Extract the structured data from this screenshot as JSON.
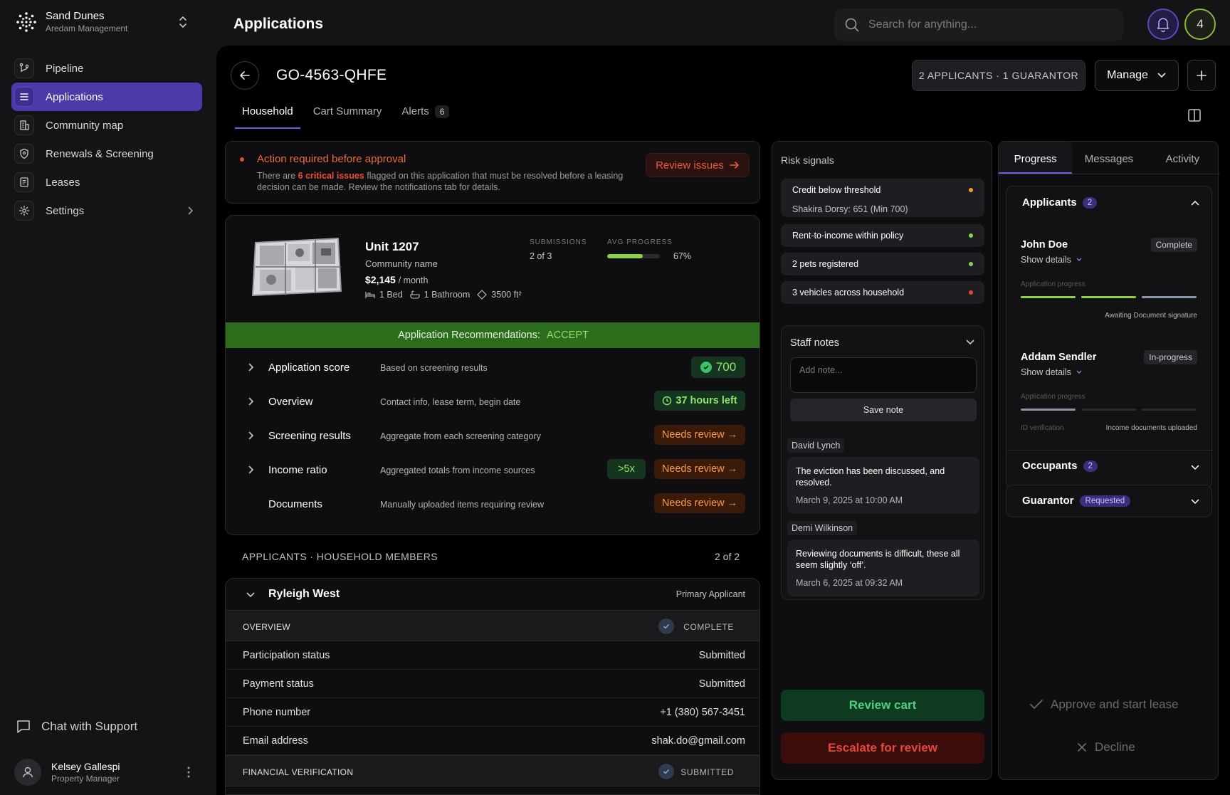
{
  "brand": {
    "name": "Sand Dunes",
    "sub": "Aredam Management"
  },
  "nav": [
    {
      "label": "Pipeline",
      "icon": "pipeline-icon"
    },
    {
      "label": "Applications",
      "icon": "list-icon",
      "active": true
    },
    {
      "label": "Community map",
      "icon": "building-icon"
    },
    {
      "label": "Renewals & Screening",
      "icon": "shield-icon"
    },
    {
      "label": "Leases",
      "icon": "document-icon"
    },
    {
      "label": "Settings",
      "icon": "gear-icon"
    }
  ],
  "support": {
    "label": "Chat with Support"
  },
  "user": {
    "name": "Kelsey Gallespi",
    "role": "Property Manager"
  },
  "header": {
    "title": "Applications",
    "search_placeholder": "Search for anything...",
    "count_badge": "4"
  },
  "application": {
    "id": "GO-4563-QHFE",
    "applicants_chip": "2 APPLICANTS · 1 GUARANTOR",
    "manage_label": "Manage",
    "tabs": [
      {
        "label": "Household",
        "active": true
      },
      {
        "label": "Cart Summary"
      },
      {
        "label": "Alerts",
        "count": "6"
      }
    ]
  },
  "alert": {
    "title": "Action required before approval",
    "text_before": "There are ",
    "text_highlight": "6 critical issues",
    "text_after": " flagged on this application that must be resolved before a leasing decision can be made. Review the notifications tab for details.",
    "button": "Review issues"
  },
  "unit": {
    "title": "Unit 1207",
    "community": "Community name",
    "price": "$2,145",
    "price_unit": "/ month",
    "beds": "1 Bed",
    "baths": "1 Bathroom",
    "area": "3500 ft²",
    "submissions_label": "SUBMISSIONS",
    "submissions_value": "2 of 3",
    "progress_label": "AVG PROGRESS",
    "progress_value": "67%",
    "progress_fraction": 0.67,
    "recommendation_label": "Application Recommendations:",
    "recommendation_value": "ACCEPT"
  },
  "checks": [
    {
      "title": "Application score",
      "desc": "Based on screening results",
      "badge": "700"
    },
    {
      "title": "Overview",
      "desc": "Contact info, lease term, begin date",
      "badge": "37 hours left"
    },
    {
      "title": "Screening results",
      "desc": "Aggregate from each screening category",
      "badge": "Needs review →"
    },
    {
      "title": "Income ratio",
      "desc": "Aggregated totals from income sources",
      "ratio": ">5x",
      "badge": "Needs review →"
    },
    {
      "title": "Documents",
      "desc": "Manually uploaded items requiring review",
      "badge": "Needs review →"
    }
  ],
  "members": {
    "heading": "APPLICANTS · HOUSEHOLD MEMBERS",
    "count": "2 of 2",
    "primary": {
      "name": "Ryleigh West",
      "role": "Primary Applicant",
      "overview_label": "OVERVIEW",
      "overview_status": "COMPLETE",
      "fields": [
        {
          "k": "Participation status",
          "v": "Submitted"
        },
        {
          "k": "Payment status",
          "v": "Submitted"
        },
        {
          "k": "Phone number",
          "v": "+1 (380) 567-3451"
        },
        {
          "k": "Email address",
          "v": "shak.do@gmail.com"
        }
      ],
      "financial_label": "FINANCIAL VERIFICATION",
      "financial_status": "SUBMITTED"
    }
  },
  "risk": {
    "title": "Risk signals",
    "signals": [
      {
        "title": "Credit below threshold",
        "sub": "Shakira Dorsy: 651 (Min 700)",
        "color": "#f0a030"
      },
      {
        "title": "Rent-to-income within policy",
        "color": "#7ed957"
      },
      {
        "title": "2 pets registered",
        "color": "#7ed957"
      },
      {
        "title": "3 vehicles across household",
        "color": "#e5483b"
      }
    ],
    "notes": {
      "title": "Staff notes",
      "placeholder": "Add note...",
      "save": "Save note",
      "items": [
        {
          "author": "David Lynch",
          "text": "The eviction has been discussed, and resolved.",
          "date": "March 9, 2025 at 10:00 AM"
        },
        {
          "author": "Demi Wilkinson",
          "text": "Reviewing documents is difficult, these all seem slightly ‘off’.",
          "date": "March 6, 2025 at 09:32 AM"
        }
      ]
    },
    "review_cart": "Review cart",
    "escalate": "Escalate for review"
  },
  "progress": {
    "tabs": [
      "Progress",
      "Messages",
      "Activity"
    ],
    "applicants_label": "Applicants",
    "applicants_count": "2",
    "people": [
      {
        "name": "John Doe",
        "status": "Complete",
        "show": "Show details",
        "progress_label": "Application progress",
        "note_right": "Awaiting Document signature"
      },
      {
        "name": "Addam Sendler",
        "status": "In-progress",
        "show": "Show details",
        "progress_label": "Application progress",
        "note_left": "ID verification",
        "note_right": "Income documents uploaded"
      }
    ],
    "occupants_label": "Occupants",
    "occupants_count": "2",
    "guarantor_label": "Guarantor",
    "guarantor_status": "Requested",
    "approve": "Approve and start lease",
    "decline": "Decline"
  }
}
